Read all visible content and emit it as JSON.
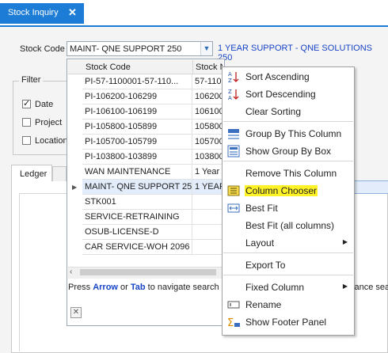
{
  "tab": {
    "title": "Stock Inquiry",
    "close": "✕"
  },
  "stock": {
    "label": "Stock Code",
    "value": "MAINT- QNE SUPPORT 250",
    "description": "1 YEAR SUPPORT - QNE SOLUTIONS 250"
  },
  "filter": {
    "title": "Filter",
    "options": [
      {
        "label": "Date",
        "checked": true
      },
      {
        "label": "Project",
        "checked": false
      },
      {
        "label": "Location",
        "checked": false
      }
    ]
  },
  "tabs": {
    "ledger": "Ledger",
    "other": "C"
  },
  "grid": {
    "columns": [
      "Stock Code",
      "Stock Name"
    ],
    "rows": [
      [
        "PI-57-1100001-57-110...",
        "57-110"
      ],
      [
        "PI-106200-106299",
        "106200"
      ],
      [
        "PI-106100-106199",
        "106100"
      ],
      [
        "PI-105800-105899",
        "105800"
      ],
      [
        "PI-105700-105799",
        "105700"
      ],
      [
        "PI-103800-103899",
        "103800"
      ],
      [
        "WAN MAINTENANCE",
        "1 Year"
      ],
      [
        "MAINT- QNE SUPPORT 250",
        "1 YEAR"
      ],
      [
        "STK001",
        ""
      ],
      [
        "SERVICE-RETRAINING",
        ""
      ],
      [
        "OSUB-LICENSE-D",
        ""
      ],
      [
        "CAR SERVICE-WOH 2096",
        ""
      ]
    ],
    "selected_index": 7
  },
  "hint": {
    "pre": "Press ",
    "arrow": "Arrow",
    "mid": " or ",
    "tab": "Tab",
    "post": " to navigate search"
  },
  "right_text": "vance sea",
  "menu": {
    "items": [
      {
        "label": "Sort Ascending",
        "icon": "sort-ascending-icon"
      },
      {
        "label": "Sort Descending",
        "icon": "sort-descending-icon"
      },
      {
        "label": "Clear Sorting",
        "icon": ""
      },
      {
        "label": "Group By This Column",
        "icon": "group-by-icon"
      },
      {
        "label": "Show Group By Box",
        "icon": "group-box-icon"
      },
      {
        "label": "Remove This Column",
        "icon": ""
      },
      {
        "label": "Column Chooser",
        "icon": "column-chooser-icon",
        "highlight": true
      },
      {
        "label": "Best Fit",
        "icon": "best-fit-icon"
      },
      {
        "label": "Best Fit (all columns)",
        "icon": ""
      },
      {
        "label": "Layout",
        "icon": "",
        "submenu": true
      },
      {
        "label": "Export To",
        "icon": ""
      },
      {
        "label": "Fixed Column",
        "icon": "",
        "submenu": true
      },
      {
        "label": "Rename",
        "icon": "rename-icon"
      },
      {
        "label": "Show Footer Panel",
        "icon": "footer-panel-icon"
      }
    ]
  },
  "colors": {
    "accent": "#1c7cd6",
    "highlight": "#fff227",
    "link": "#1844c6"
  }
}
